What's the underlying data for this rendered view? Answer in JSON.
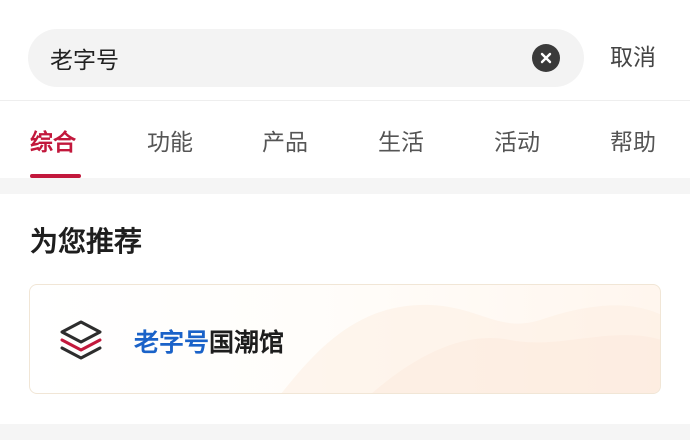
{
  "search": {
    "value": "老字号",
    "cancel_label": "取消"
  },
  "tabs": [
    {
      "label": "综合",
      "active": true
    },
    {
      "label": "功能",
      "active": false
    },
    {
      "label": "产品",
      "active": false
    },
    {
      "label": "生活",
      "active": false
    },
    {
      "label": "活动",
      "active": false
    },
    {
      "label": "帮助",
      "active": false
    }
  ],
  "recommend": {
    "title": "为您推荐",
    "items": [
      {
        "icon": "layers-icon",
        "highlight": "老字号",
        "rest": "国潮馆"
      }
    ]
  },
  "colors": {
    "accent": "#c2183c",
    "highlight": "#1a62c8",
    "search_bg": "#f3f3f3"
  }
}
